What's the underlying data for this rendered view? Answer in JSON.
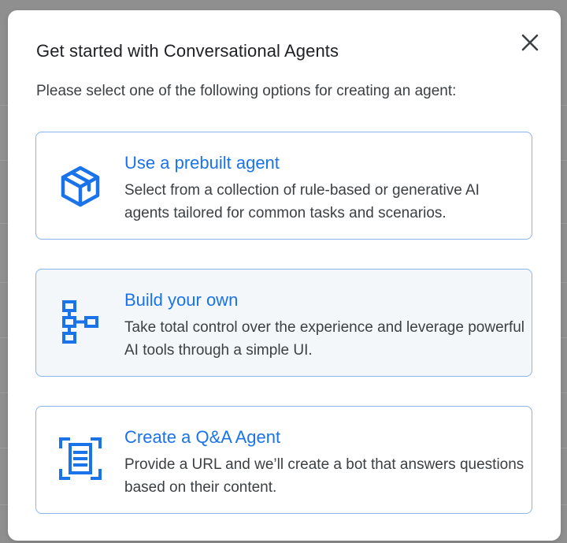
{
  "dialog": {
    "title": "Get started with Conversational Agents",
    "subtitle": "Please select one of the following options for creating an agent:",
    "close_icon": "close-icon"
  },
  "options": [
    {
      "title": "Use a prebuilt agent",
      "description": "Select from a collection of rule-based or generative AI agents tailored for common tasks and scenarios.",
      "icon": "cube-icon",
      "selected": false
    },
    {
      "title": "Build your own",
      "description": "Take total control over the experience and leverage powerful AI tools through a simple UI.",
      "icon": "flow-diagram-icon",
      "selected": true
    },
    {
      "title": "Create a Q&A Agent",
      "description": "Provide a URL and we’ll create a bot that answers questions based on their content.",
      "icon": "document-scan-icon",
      "selected": false
    }
  ],
  "colors": {
    "accent": "#1a73e8",
    "border": "#89b4ee",
    "selected_background": "#f4f7fa",
    "scrim": "#8f8f8f"
  }
}
